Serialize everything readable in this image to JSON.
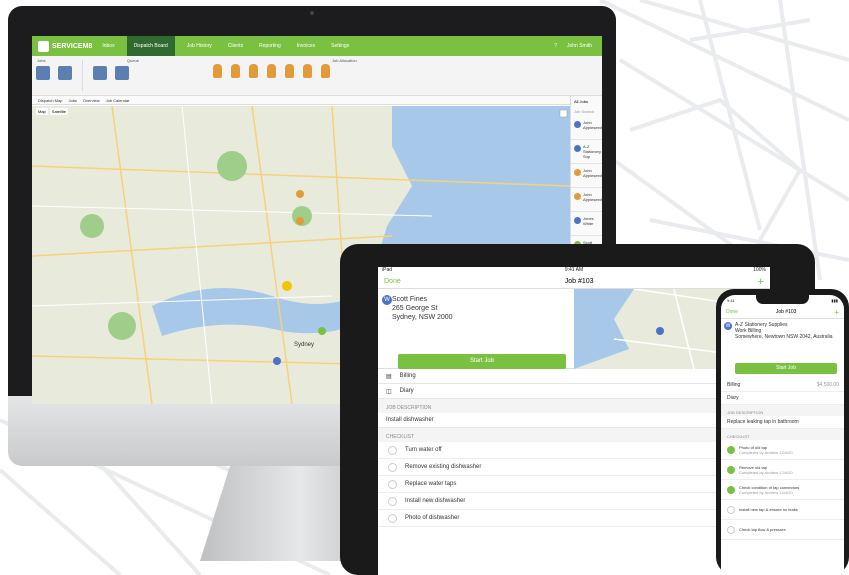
{
  "desktop": {
    "brand": "SERVICEM8",
    "nav": [
      "Inbox",
      "Dispatch Board",
      "Job History",
      "Clients",
      "Reporting",
      "Invoices",
      "Settings"
    ],
    "active_nav": "Dispatch Board",
    "user": "John Smith",
    "ribbon_sections": [
      "Jobs",
      "Queue",
      "Job Allocation"
    ],
    "tabs": [
      "Dispatch Map",
      "Jobs",
      "Overview",
      "Job Calendar"
    ],
    "map_modes": [
      "Map",
      "Satellite"
    ],
    "map_city_label": "Sydney",
    "sidebar_filter": "All Jobs",
    "sidebar_heading": "Job Search",
    "sidebar_jobs": [
      {
        "title": "John Appleseed",
        "color": "#4a73c5"
      },
      {
        "title": "A-Z Stationery Sup",
        "color": "#4a73c5"
      },
      {
        "title": "John Appleseed",
        "color": "#e39b3a"
      },
      {
        "title": "John Appleseed",
        "color": "#e39b3a"
      },
      {
        "title": "Jones White",
        "color": "#4a73c5"
      },
      {
        "title": "Scott Fines",
        "color": "#7ac142"
      }
    ]
  },
  "tablet": {
    "carrier": "iPad",
    "time": "9:41 AM",
    "battery": "100%",
    "done": "Done",
    "title": "Job #103",
    "add": "+",
    "customer_name": "Scott Fines",
    "address_line1": "265 George St",
    "address_line2": "Sydney, NSW 2000",
    "avatar_letter": "W",
    "start_button": "Start Job",
    "rows": [
      "Billing",
      "Diary"
    ],
    "job_description_heading": "JOB DESCRIPTION",
    "job_description": "Install dishwasher",
    "checklist_heading": "CHECKLIST",
    "checklist": [
      "Turn water off",
      "Remove existing dishwasher",
      "Replace water taps",
      "Install new dishwasher",
      "Photo of dishwasher"
    ]
  },
  "phone": {
    "time": "9:41",
    "done": "Done",
    "title": "Job #103",
    "customer_name": "A-Z Stationery Supplies",
    "customer_line2": "Work Billing",
    "address": "Somewhere, Newtown NSW 2042, Australia",
    "start_button": "Start Job",
    "billing": "Billing",
    "billing_amount": "$4,500.00",
    "diary": "Diary",
    "job_description_heading": "JOB DESCRIPTION",
    "job_description": "Replace leaking tap in bathroom",
    "checklist_heading": "CHECKLIST",
    "checklist": [
      {
        "label": "Photo of old tap",
        "note": "Completed by Andrew 12/4/20"
      },
      {
        "label": "Remove old tap",
        "note": "Completed by Andrew 12/4/20"
      },
      {
        "label": "Check condition of tap connectors",
        "note": "Completed by Andrew 12/4/20"
      },
      {
        "label": "Install new tap & ensure no leaks",
        "note": ""
      },
      {
        "label": "Check tap flow & pressure",
        "note": ""
      }
    ]
  }
}
